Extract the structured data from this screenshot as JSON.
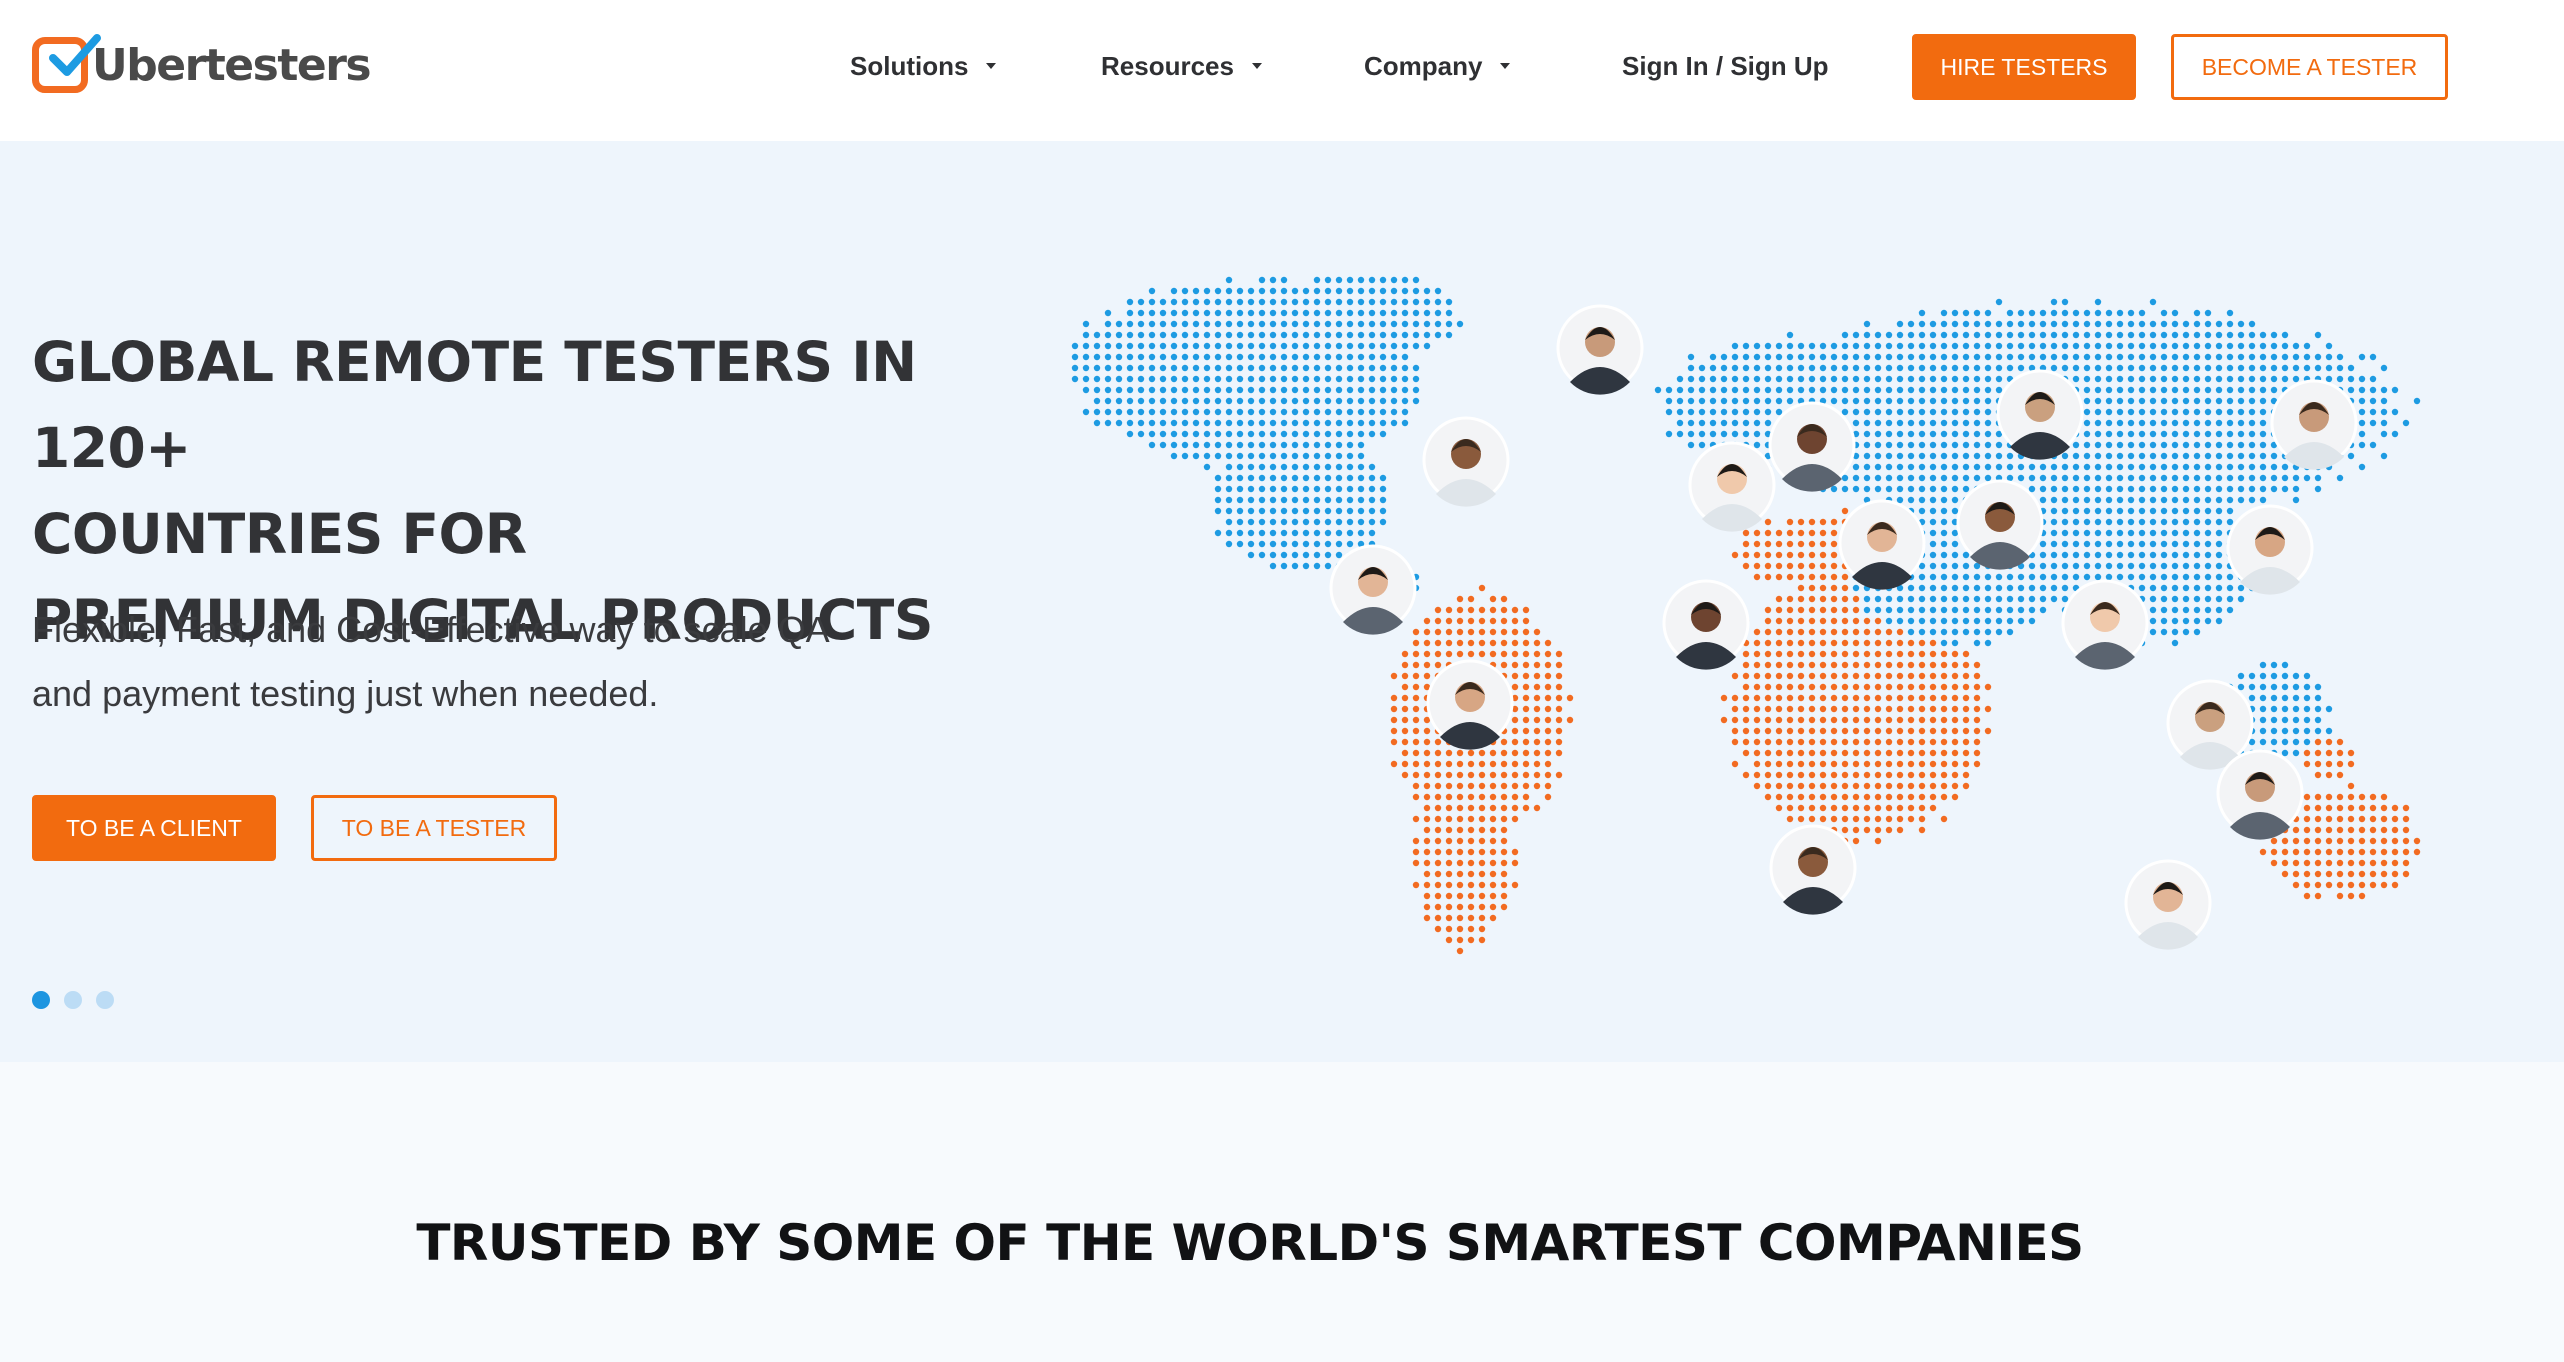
{
  "brand": {
    "name": "Ubertesters",
    "accent_color": "#f26b0f",
    "map_blue": "#1d9be2",
    "map_orange": "#f26b21"
  },
  "nav": {
    "items": [
      {
        "label": "Solutions",
        "icon": "caret-down-icon"
      },
      {
        "label": "Resources",
        "icon": "caret-down-icon"
      },
      {
        "label": "Company",
        "icon": "caret-down-icon"
      }
    ],
    "signin_label": "Sign In / Sign Up",
    "hire_label": "HIRE TESTERS",
    "become_label": "BECOME A TESTER"
  },
  "hero": {
    "title_lines": [
      "GLOBAL REMOTE TESTERS IN 120+",
      "COUNTRIES FOR",
      "PREMIUM DIGITAL PRODUCTS"
    ],
    "subtitle_lines": [
      "Flexible, Fast, and Cost-Effective way to scale QA",
      "and payment testing just when needed."
    ],
    "client_button": "TO BE A CLIENT",
    "tester_button": "TO BE A TESTER",
    "slides": 3,
    "active_slide": 0
  },
  "trusted": {
    "title": "TRUSTED BY SOME OF THE WORLD'S SMARTEST COMPANIES"
  }
}
